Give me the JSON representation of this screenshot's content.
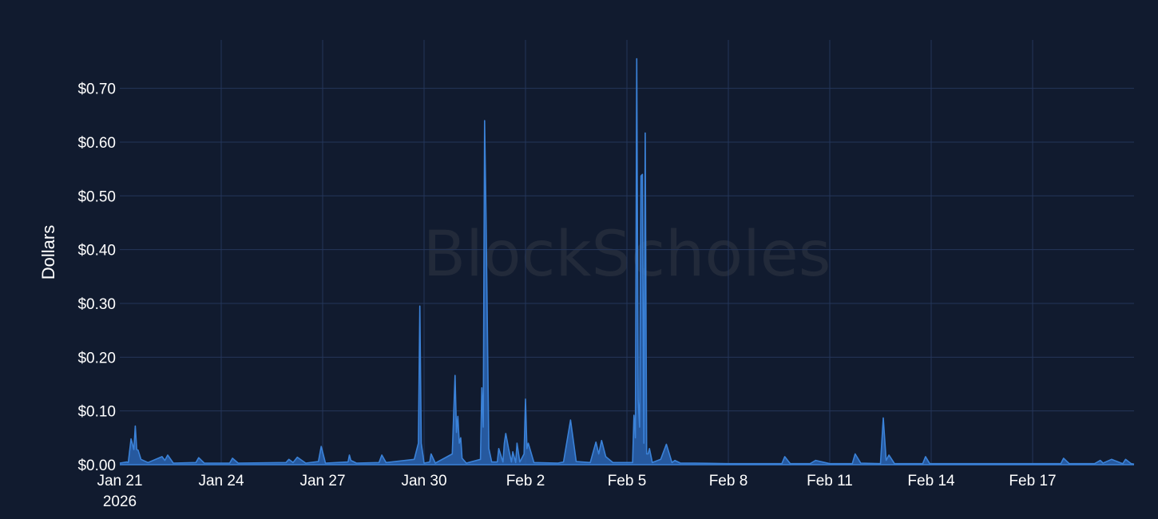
{
  "watermark": "BlockScholes",
  "chart_data": {
    "type": "area",
    "title": "",
    "xlabel": "",
    "ylabel": "Dollars",
    "ylim": [
      0,
      0.79
    ],
    "xlim": [
      "2026-01-21T00:00",
      "2026-02-20T00:00"
    ],
    "yticks": [
      {
        "value": 0.0,
        "label": "$0.00"
      },
      {
        "value": 0.1,
        "label": "$0.10"
      },
      {
        "value": 0.2,
        "label": "$0.20"
      },
      {
        "value": 0.3,
        "label": "$0.30"
      },
      {
        "value": 0.4,
        "label": "$0.40"
      },
      {
        "value": 0.5,
        "label": "$0.50"
      },
      {
        "value": 0.6,
        "label": "$0.60"
      },
      {
        "value": 0.7,
        "label": "$0.70"
      }
    ],
    "xticks": [
      {
        "value": "2026-01-21T00:00",
        "label": "Jan 21",
        "sublabel": "2026"
      },
      {
        "value": "2026-01-24T00:00",
        "label": "Jan 24"
      },
      {
        "value": "2026-01-27T00:00",
        "label": "Jan 27"
      },
      {
        "value": "2026-01-30T00:00",
        "label": "Jan 30"
      },
      {
        "value": "2026-02-02T00:00",
        "label": "Feb 2"
      },
      {
        "value": "2026-02-05T00:00",
        "label": "Feb 5"
      },
      {
        "value": "2026-02-08T00:00",
        "label": "Feb 8"
      },
      {
        "value": "2026-02-11T00:00",
        "label": "Feb 11"
      },
      {
        "value": "2026-02-14T00:00",
        "label": "Feb 14"
      },
      {
        "value": "2026-02-17T00:00",
        "label": "Feb 17"
      }
    ],
    "grid": true,
    "colors": {
      "background": "#111b2f",
      "grid": "#24365a",
      "line": "#3b82d8",
      "fill": "#2a64b3"
    },
    "series": [
      {
        "x": [
          "2026-01-21T00:00",
          "2026-01-21T05:00",
          "2026-01-21T06:00",
          "2026-01-21T08:00",
          "2026-01-21T10:00",
          "2026-01-21T11:00",
          "2026-01-21T12:00",
          "2026-01-21T13:00",
          "2026-01-21T15:00",
          "2026-01-21T20:00",
          "2026-01-22T06:00",
          "2026-01-22T08:00",
          "2026-01-22T10:00",
          "2026-01-22T14:00",
          "2026-01-23T06:00",
          "2026-01-23T08:00",
          "2026-01-23T12:00",
          "2026-01-24T06:00",
          "2026-01-24T08:00",
          "2026-01-24T12:00",
          "2026-01-25T22:00",
          "2026-01-26T00:00",
          "2026-01-26T03:00",
          "2026-01-26T06:00",
          "2026-01-26T12:00",
          "2026-01-26T21:00",
          "2026-01-26T23:00",
          "2026-01-27T02:00",
          "2026-01-27T18:00",
          "2026-01-27T19:00",
          "2026-01-27T20:00",
          "2026-01-28T00:00",
          "2026-01-28T16:00",
          "2026-01-28T18:00",
          "2026-01-28T21:00",
          "2026-01-29T17:00",
          "2026-01-29T20:00",
          "2026-01-29T21:00",
          "2026-01-29T22:00",
          "2026-01-30T00:00",
          "2026-01-30T04:00",
          "2026-01-30T05:00",
          "2026-01-30T08:00",
          "2026-01-30T20:00",
          "2026-01-30T22:00",
          "2026-01-30T23:00",
          "2026-01-31T00:00",
          "2026-01-31T01:00",
          "2026-01-31T02:00",
          "2026-01-31T03:00",
          "2026-01-31T06:00",
          "2026-01-31T16:00",
          "2026-01-31T17:00",
          "2026-01-31T18:00",
          "2026-01-31T19:00",
          "2026-01-31T20:00",
          "2026-01-31T22:00",
          "2026-02-01T00:00",
          "2026-02-01T04:00",
          "2026-02-01T05:00",
          "2026-02-01T08:00",
          "2026-02-01T09:00",
          "2026-02-01T10:00",
          "2026-02-01T12:00",
          "2026-02-01T14:00",
          "2026-02-01T15:00",
          "2026-02-01T17:00",
          "2026-02-01T18:00",
          "2026-02-01T20:00",
          "2026-02-01T23:00",
          "2026-02-02T00:00",
          "2026-02-02T01:00",
          "2026-02-02T02:00",
          "2026-02-02T06:00",
          "2026-02-02T23:00",
          "2026-02-03T03:00",
          "2026-02-03T08:00",
          "2026-02-03T12:00",
          "2026-02-03T22:00",
          "2026-02-04T02:00",
          "2026-02-04T04:00",
          "2026-02-04T06:00",
          "2026-02-04T09:00",
          "2026-02-04T14:00",
          "2026-02-05T04:00",
          "2026-02-05T05:00",
          "2026-02-05T06:00",
          "2026-02-05T07:00",
          "2026-02-05T08:00",
          "2026-02-05T09:00",
          "2026-02-05T10:00",
          "2026-02-05T11:00",
          "2026-02-05T12:00",
          "2026-02-05T13:00",
          "2026-02-05T14:00",
          "2026-02-05T15:00",
          "2026-02-05T16:00",
          "2026-02-05T18:00",
          "2026-02-06T00:00",
          "2026-02-06T04:00",
          "2026-02-06T08:00",
          "2026-02-06T10:00",
          "2026-02-06T14:00",
          "2026-02-07T00:00",
          "2026-02-08T00:00",
          "2026-02-09T00:00",
          "2026-02-09T14:00",
          "2026-02-09T16:00",
          "2026-02-09T20:00",
          "2026-02-10T10:00",
          "2026-02-10T14:00",
          "2026-02-11T00:00",
          "2026-02-11T16:00",
          "2026-02-11T18:00",
          "2026-02-11T22:00",
          "2026-02-12T12:00",
          "2026-02-12T14:00",
          "2026-02-12T16:00",
          "2026-02-12T18:00",
          "2026-02-12T22:00",
          "2026-02-13T18:00",
          "2026-02-13T20:00",
          "2026-02-13T23:00",
          "2026-02-14T12:00",
          "2026-02-15T00:00",
          "2026-02-16T00:00",
          "2026-02-17T00:00",
          "2026-02-17T20:00",
          "2026-02-17T22:00",
          "2026-02-18T02:00",
          "2026-02-18T20:00",
          "2026-02-19T00:00",
          "2026-02-19T02:00",
          "2026-02-19T08:00",
          "2026-02-19T16:00",
          "2026-02-19T18:00",
          "2026-02-19T22:00",
          "2026-02-20T00:00"
        ],
        "y": [
          0.003,
          0.005,
          0.004,
          0.048,
          0.028,
          0.072,
          0.028,
          0.027,
          0.01,
          0.004,
          0.015,
          0.008,
          0.018,
          0.003,
          0.004,
          0.013,
          0.003,
          0.003,
          0.012,
          0.003,
          0.004,
          0.01,
          0.004,
          0.014,
          0.003,
          0.006,
          0.034,
          0.003,
          0.005,
          0.018,
          0.008,
          0.003,
          0.004,
          0.018,
          0.004,
          0.01,
          0.04,
          0.295,
          0.04,
          0.003,
          0.005,
          0.02,
          0.003,
          0.02,
          0.166,
          0.06,
          0.09,
          0.04,
          0.05,
          0.012,
          0.003,
          0.01,
          0.143,
          0.07,
          0.64,
          0.46,
          0.03,
          0.005,
          0.005,
          0.03,
          0.005,
          0.04,
          0.058,
          0.03,
          0.005,
          0.024,
          0.004,
          0.04,
          0.005,
          0.02,
          0.122,
          0.03,
          0.04,
          0.004,
          0.003,
          0.005,
          0.083,
          0.006,
          0.004,
          0.042,
          0.02,
          0.045,
          0.015,
          0.004,
          0.004,
          0.092,
          0.05,
          0.755,
          0.12,
          0.07,
          0.537,
          0.54,
          0.04,
          0.617,
          0.02,
          0.02,
          0.03,
          0.004,
          0.01,
          0.038,
          0.004,
          0.008,
          0.003,
          0.003,
          0.002,
          0.002,
          0.002,
          0.015,
          0.002,
          0.002,
          0.008,
          0.002,
          0.002,
          0.02,
          0.003,
          0.002,
          0.087,
          0.008,
          0.018,
          0.002,
          0.002,
          0.015,
          0.002,
          0.002,
          0.002,
          0.002,
          0.002,
          0.002,
          0.012,
          0.002,
          0.002,
          0.008,
          0.003,
          0.01,
          0.002,
          0.01,
          0.002,
          0.001
        ]
      }
    ]
  }
}
